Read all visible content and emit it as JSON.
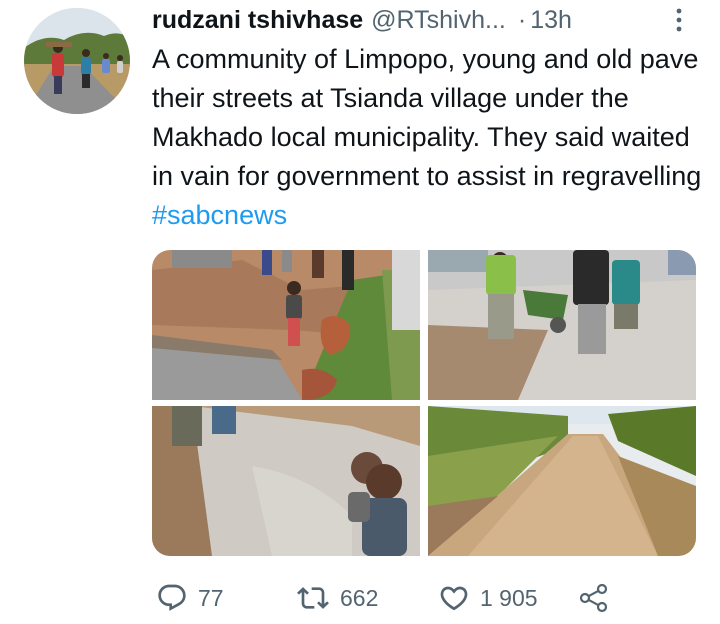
{
  "tweet": {
    "author_name": "rudzani tshivhase",
    "handle": "@RTshivh...",
    "separator": "·",
    "time": "13h",
    "text": "A community of Limpopo, young and old pave their streets at Tsianda village under the Makhado local municipality. They said waited in vain for government to assist in regravelling ",
    "hashtag": "#sabcnews"
  },
  "actions": {
    "replies": "77",
    "retweets": "662",
    "likes": "1 905"
  },
  "icons": {
    "more": "more-vertical-icon",
    "reply": "reply-icon",
    "retweet": "retweet-icon",
    "like": "heart-icon",
    "share": "share-icon"
  },
  "colors": {
    "text": "#0f1419",
    "secondary": "#536471",
    "link": "#1d9bf0"
  }
}
